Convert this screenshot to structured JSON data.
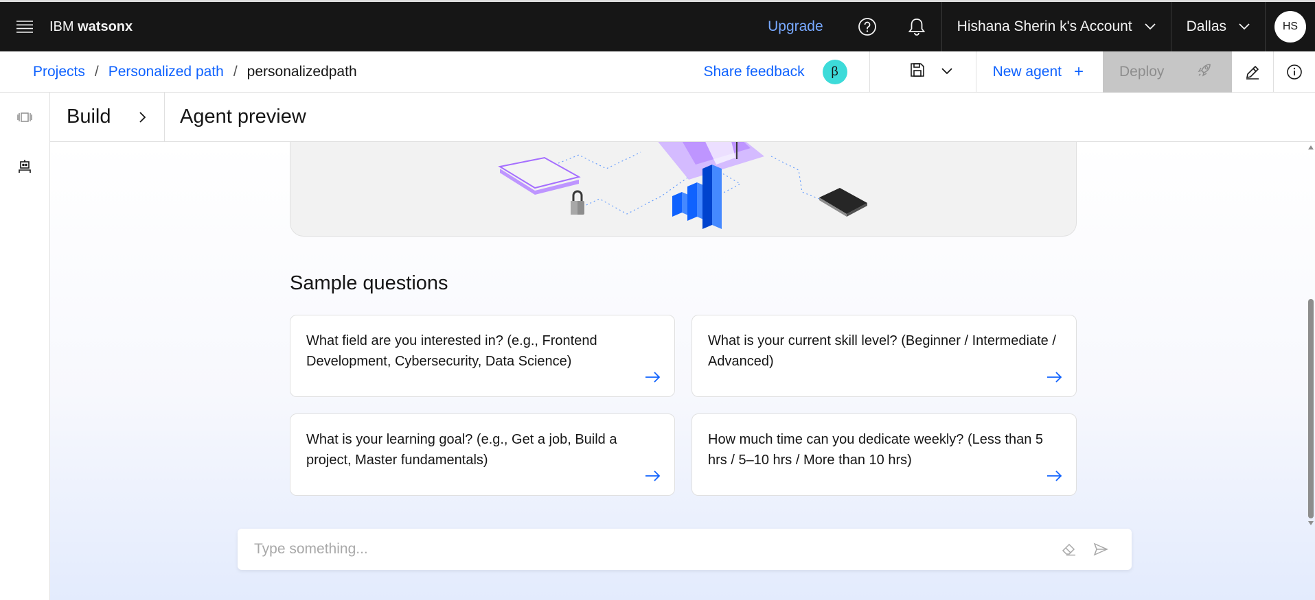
{
  "topbar": {
    "brand_prefix": "IBM",
    "brand_name": "watsonx",
    "upgrade_label": "Upgrade",
    "account_label": "Hishana Sherin k's Account",
    "region_label": "Dallas",
    "avatar_initials": "HS",
    "icons": [
      "menu-icon",
      "help-icon",
      "notification-icon",
      "chevron-down-icon"
    ]
  },
  "breadcrumb": {
    "items": [
      {
        "label": "Projects"
      },
      {
        "label": "Personalized path"
      }
    ],
    "separator": "/",
    "current": "personalizedpath"
  },
  "toolbar": {
    "share_feedback": "Share feedback",
    "beta_badge": "β",
    "new_agent_label": "New agent",
    "new_agent_icon": "+",
    "deploy_label": "Deploy",
    "icons": [
      "save-icon",
      "chevron-down-icon",
      "add-icon",
      "rocket-icon",
      "edit-icon",
      "info-icon"
    ]
  },
  "rail": {
    "icons": [
      "panel-icon",
      "agent-icon"
    ]
  },
  "header": {
    "build_label": "Build",
    "title": "Agent preview"
  },
  "main": {
    "sample_title": "Sample questions",
    "questions": [
      {
        "text": "What field are you interested in? (e.g., Frontend Development, Cybersecurity, Data Science)"
      },
      {
        "text": "What is your current skill level? (Beginner / Intermediate / Advanced)"
      },
      {
        "text": "What is your learning goal? (e.g., Get a job, Build a project, Master fundamentals)"
      },
      {
        "text": "How much time can you dedicate weekly? (Less than 5 hrs / 5–10 hrs / More than 10 hrs)"
      }
    ]
  },
  "composer": {
    "placeholder": "Type something...",
    "value": ""
  },
  "colors": {
    "topbar_bg": "#161616",
    "link": "#0f62fe",
    "upgrade": "#78a9ff",
    "beta_badge": "#3ddbd9",
    "deploy_disabled_bg": "#c6c6c6"
  }
}
